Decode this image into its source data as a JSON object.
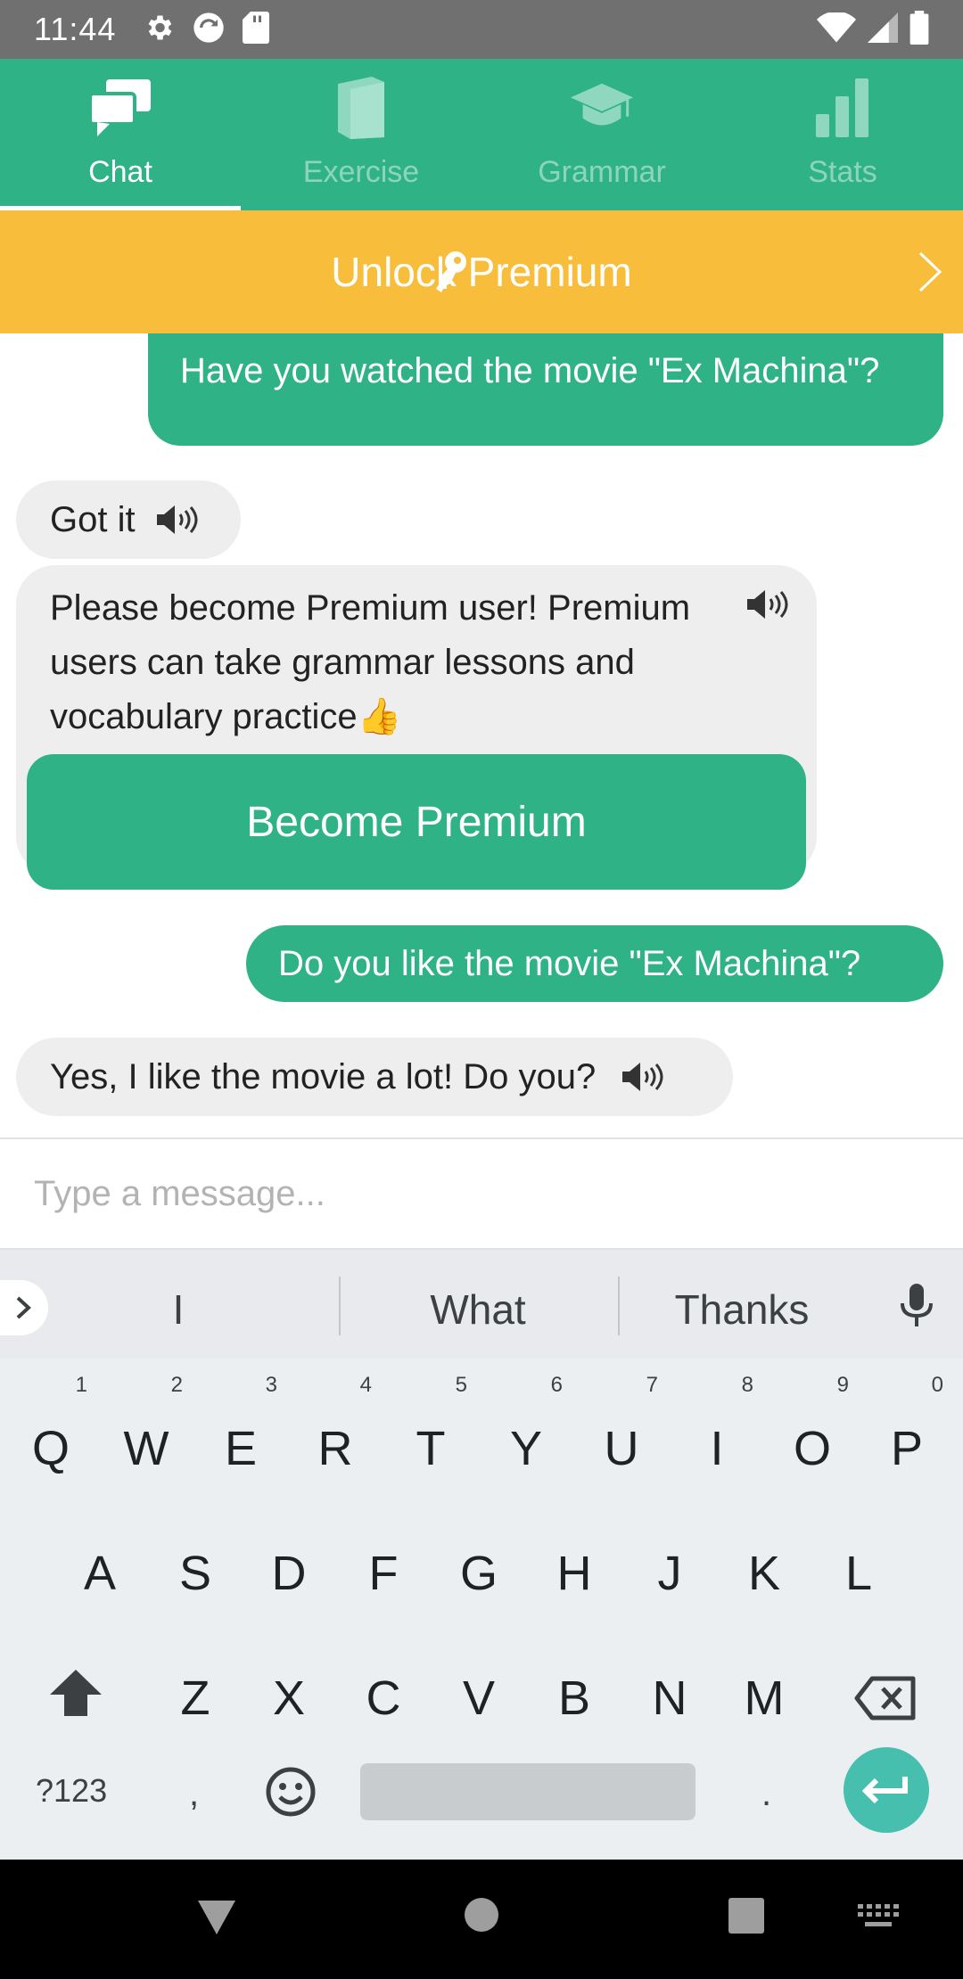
{
  "status_bar": {
    "time": "11:44"
  },
  "tabs": [
    {
      "label": "Chat",
      "icon": "chat-bubbles-icon",
      "active": true
    },
    {
      "label": "Exercise",
      "icon": "book-icon",
      "active": false
    },
    {
      "label": "Grammar",
      "icon": "graduation-cap-icon",
      "active": false
    },
    {
      "label": "Stats",
      "icon": "bar-chart-icon",
      "active": false
    }
  ],
  "banner": {
    "label": "Unlock Premium",
    "icon": "key-icon"
  },
  "messages": [
    {
      "from": "user",
      "text": "Have you watched the movie \"Ex Machina\"?"
    },
    {
      "from": "bot",
      "text": "Got it"
    },
    {
      "from": "bot",
      "text": "Please become Premium user! Premium users can take grammar lessons and vocabulary practice👍",
      "button": "Become Premium"
    },
    {
      "from": "user",
      "text": "Do you like the movie \"Ex Machina\"?"
    },
    {
      "from": "bot",
      "text": "Yes, I like the movie a lot! Do you?"
    }
  ],
  "composer": {
    "placeholder": "Type a message..."
  },
  "keyboard": {
    "suggestions": [
      "I",
      "What",
      "Thanks"
    ],
    "row1": [
      "Q",
      "W",
      "E",
      "R",
      "T",
      "Y",
      "U",
      "I",
      "O",
      "P"
    ],
    "row1_hints": [
      "1",
      "2",
      "3",
      "4",
      "5",
      "6",
      "7",
      "8",
      "9",
      "0"
    ],
    "row2": [
      "A",
      "S",
      "D",
      "F",
      "G",
      "H",
      "J",
      "K",
      "L"
    ],
    "row3": [
      "Z",
      "X",
      "C",
      "V",
      "B",
      "N",
      "M"
    ],
    "symbols_label": "?123",
    "comma": ",",
    "period": "."
  },
  "colors": {
    "brand": "#2fb386",
    "premium": "#f8be3b",
    "bubble_bot": "#eeeeee",
    "enter": "#46bfae"
  }
}
